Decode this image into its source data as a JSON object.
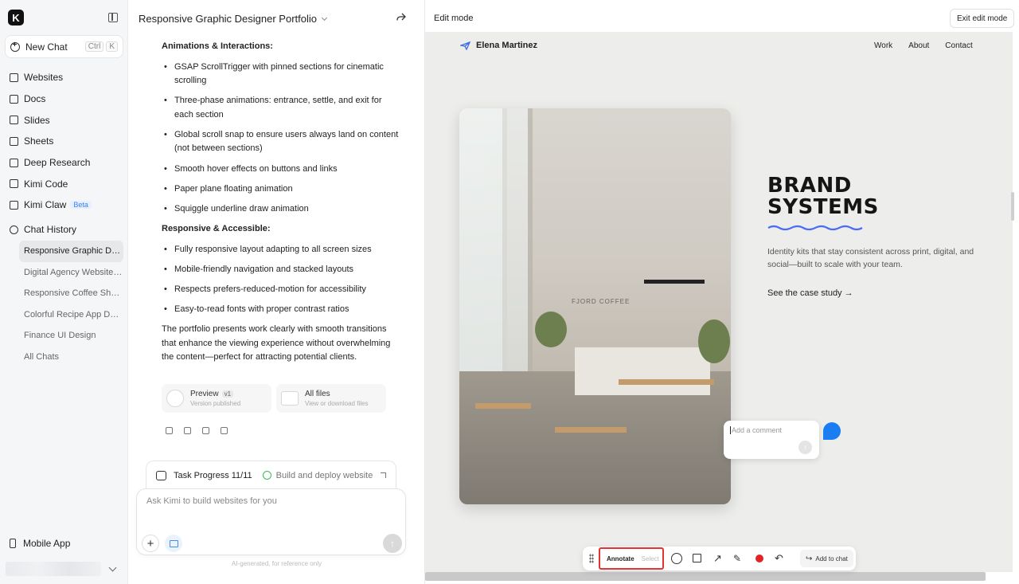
{
  "sidebar": {
    "logo": "K",
    "new_chat": "New Chat",
    "shortcut": [
      "Ctrl",
      "K"
    ],
    "nav": [
      {
        "label": "Websites",
        "icon": "browser-icon"
      },
      {
        "label": "Docs",
        "icon": "doc-icon"
      },
      {
        "label": "Slides",
        "icon": "slides-icon"
      },
      {
        "label": "Sheets",
        "icon": "sheet-icon"
      },
      {
        "label": "Deep Research",
        "icon": "research-icon"
      },
      {
        "label": "Kimi Code",
        "icon": "code-icon"
      },
      {
        "label": "Kimi Claw",
        "icon": "claw-icon",
        "badge": "Beta"
      }
    ],
    "history_label": "Chat History",
    "history": [
      "Responsive Graphic Design...",
      "Digital Agency Website De...",
      "Responsive Coffee Shop W...",
      "Colorful Recipe App Design",
      "Finance UI Design",
      "All Chats"
    ],
    "mobile_app": "Mobile App"
  },
  "chat": {
    "title": "Responsive Graphic Designer Portfolio",
    "section1_title": "Animations & Interactions:",
    "section1_items": [
      "GSAP ScrollTrigger with pinned sections for cinematic scrolling",
      "Three-phase animations: entrance, settle, and exit for each section",
      "Global scroll snap to ensure users always land on content (not between sections)",
      "Smooth hover effects on buttons and links",
      "Paper plane floating animation",
      "Squiggle underline draw animation"
    ],
    "section2_title": "Responsive & Accessible:",
    "section2_items": [
      "Fully responsive layout adapting to all screen sizes",
      "Mobile-friendly navigation and stacked layouts",
      "Respects prefers-reduced-motion for accessibility",
      "Easy-to-read fonts with proper contrast ratios"
    ],
    "summary": "The portfolio presents work clearly with smooth transitions that enhance the viewing experience without overwhelming the content—perfect for attracting potential clients.",
    "card_preview": {
      "title": "Preview",
      "version": "v1",
      "sub": "Version published"
    },
    "card_files": {
      "title": "All files",
      "sub": "View or download files"
    },
    "task_progress": "Task Progress 11/11",
    "task_status": "Build and deploy website",
    "input_placeholder": "Ask Kimi to build websites for you",
    "disclaimer": "AI-generated, for reference only"
  },
  "preview": {
    "mode_label": "Edit mode",
    "exit_label": "Exit edit mode",
    "site": {
      "brand": "Elena Martinez",
      "nav": [
        "Work",
        "About",
        "Contact"
      ],
      "photo_sign": "FJORD COFFEE",
      "hero_title_line1": "BRAND",
      "hero_title_line2": "SYSTEMS",
      "hero_desc": "Identity kits that stay consistent across print, digital, and social—built to scale with your team.",
      "case_link": "See the case study",
      "case_arrow": "→",
      "comment_placeholder": "Add a comment",
      "accent_color": "#4a6cf7"
    },
    "toolbar": {
      "annotate": "Annotate",
      "select": "Select",
      "add_to_chat": "Add to chat",
      "active_color": "#e02424"
    }
  }
}
